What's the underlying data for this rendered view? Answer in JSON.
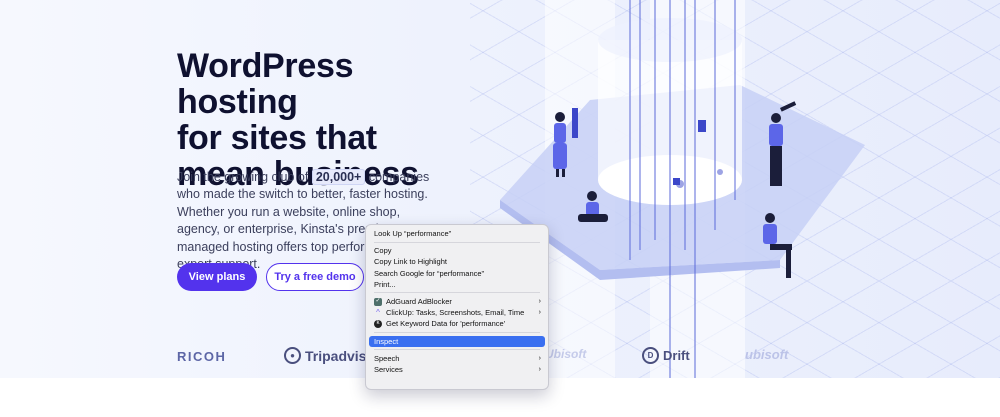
{
  "hero": {
    "headline": [
      "WordPress hosting",
      "for sites that",
      "mean business"
    ],
    "intro_before": "Join the growing club of ",
    "intro_stat": "20,000+",
    "intro_after": " companies who made the switch to better, faster hosting. Whether you run a website, online shop, agency, or enterprise, Kinsta's premium managed hosting offers top performance and expert support.",
    "primary_button": "View plans",
    "secondary_button": "Try a free demo",
    "brand_color": "#5333ed"
  },
  "logos": {
    "ricoh": "RICOH",
    "tripadvisor": "Tripadvisor",
    "drift": "Drift",
    "faint_a": "Ubisoft",
    "faint_b": "ubisoft"
  },
  "context_menu": {
    "items": [
      {
        "label": "Look Up “performance”"
      },
      {
        "label": "Copy"
      },
      {
        "label": "Copy Link to Highlight"
      },
      {
        "label": "Search Google for “performance”"
      },
      {
        "label": "Print..."
      },
      {
        "label": "AdGuard AdBlocker",
        "icon": "adguard-icon",
        "submenu": true
      },
      {
        "label": "ClickUp: Tasks, Screenshots, Email, Time",
        "icon": "clickup-icon",
        "submenu": true
      },
      {
        "label": "Get Keyword Data for 'performance'",
        "icon": "keyword-icon"
      },
      {
        "label": "Inspect",
        "active": true
      },
      {
        "label": "Speech",
        "submenu": true
      },
      {
        "label": "Services",
        "submenu": true
      }
    ],
    "highlight_color": "#3a6ff0"
  }
}
